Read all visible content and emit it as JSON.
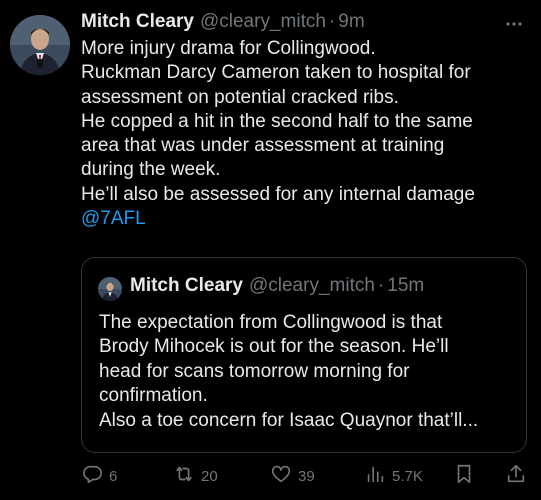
{
  "tweet": {
    "author_name": "Mitch Cleary",
    "author_handle": "@cleary_mitch",
    "separator": "·",
    "timestamp": "9m",
    "body_lines": [
      "More injury drama for Collingwood.",
      "Ruckman Darcy Cameron taken to hospital for",
      "assessment on potential cracked ribs.",
      "He copped a hit in the second half to the same",
      "area that was under assessment at training",
      "during the week.",
      "He’ll also be assessed for any internal damage"
    ],
    "mention": "@7AFL"
  },
  "quote": {
    "author_name": "Mitch Cleary",
    "author_handle": "@cleary_mitch",
    "separator": "·",
    "timestamp": "15m",
    "body_lines": [
      "The expectation from Collingwood is that",
      "Brody Mihocek is out for the season. He’ll",
      "head for scans tomorrow morning for",
      "confirmation.",
      "Also a toe concern for Isaac Quaynor that’ll..."
    ]
  },
  "actions": {
    "replies": "6",
    "reposts": "20",
    "likes": "39",
    "views": "5.7K"
  },
  "icons": {
    "more": "more-horizontal-icon",
    "reply": "reply-icon",
    "repost": "repost-icon",
    "like": "heart-icon",
    "views": "views-chart-icon",
    "bookmark": "bookmark-icon",
    "share": "share-icon"
  },
  "colors": {
    "background": "#000000",
    "text_primary": "#e7e9ea",
    "text_secondary": "#71767b",
    "link": "#1d9bf0",
    "border": "#2f3336"
  }
}
